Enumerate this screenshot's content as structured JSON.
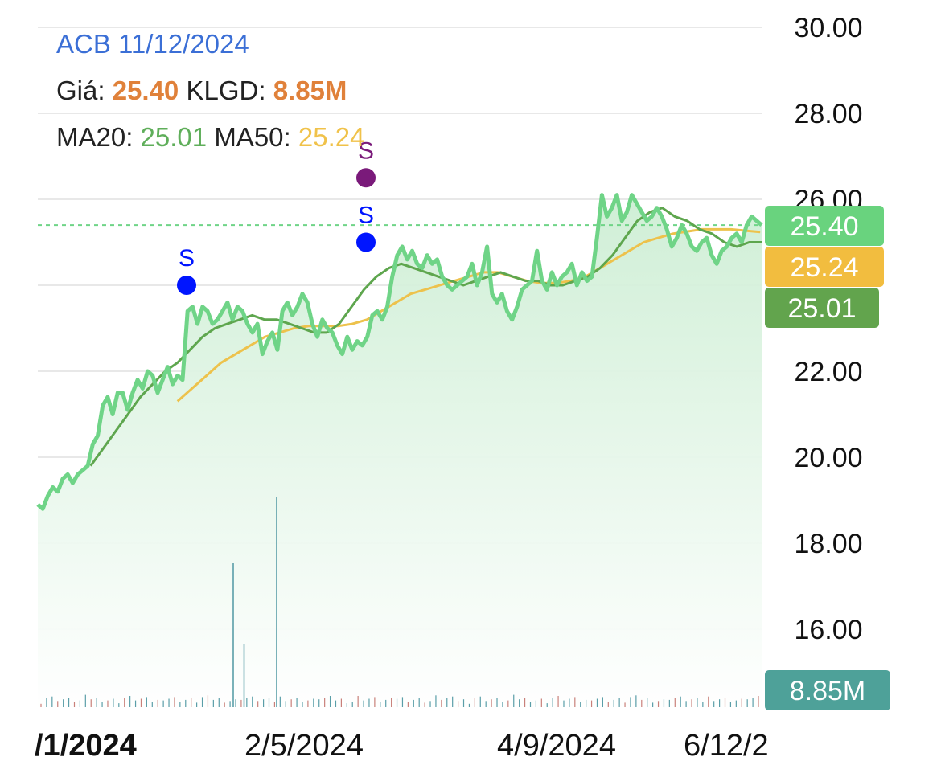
{
  "header": {
    "ticker_date": "ACB 11/12/2024",
    "price_label": "Giá:",
    "price_value": "25.40",
    "volume_label": "KLGD:",
    "volume_value": "8.85M",
    "ma20_label": "MA20:",
    "ma20_value": "25.01",
    "ma50_label": "MA50:",
    "ma50_value": "25.24"
  },
  "badges": {
    "price": "25.40",
    "ma50": "25.24",
    "ma20": "25.01",
    "volume": "8.85M"
  },
  "colors": {
    "price_line": "#6fd487",
    "price_fill_top": "#cdeed4",
    "ma20": "#5ea64e",
    "ma50": "#edc24c",
    "grid": "#e8e8e8",
    "volume_bar": "#5a9ea8",
    "price_badge": "#69d37e",
    "ma50_badge": "#f2bd3f",
    "ma20_badge": "#62a44d",
    "volume_badge": "#4ea199",
    "signal_blue": "#0015ff",
    "signal_purple": "#7a1a7a"
  },
  "chart_data": {
    "type": "line",
    "ylim": [
      14,
      30.6
    ],
    "y_ticks": [
      "30.00",
      "28.00",
      "26.00",
      "22.00",
      "20.00",
      "18.00",
      "16.00"
    ],
    "x_ticks": [
      "/1/2024",
      "2/5/2024",
      "4/9/2024",
      "6/12/2"
    ],
    "current_price": 25.4,
    "series": [
      {
        "name": "Giá",
        "values": [
          18.9,
          18.8,
          19.1,
          19.3,
          19.2,
          19.5,
          19.6,
          19.4,
          19.6,
          19.7,
          19.8,
          20.3,
          20.5,
          21.2,
          21.4,
          21.0,
          21.5,
          21.5,
          21.1,
          21.5,
          21.8,
          21.6,
          22.0,
          21.9,
          21.5,
          21.8,
          22.1,
          21.7,
          21.9,
          21.8,
          23.4,
          23.5,
          23.1,
          23.5,
          23.4,
          23.1,
          23.2,
          23.4,
          23.6,
          23.2,
          23.5,
          23.4,
          23.1,
          22.9,
          23.1,
          22.4,
          22.7,
          22.9,
          22.5,
          23.4,
          23.6,
          23.3,
          23.5,
          23.8,
          23.6,
          23.1,
          22.8,
          23.2,
          23.0,
          22.9,
          22.6,
          22.4,
          22.8,
          22.5,
          22.7,
          22.6,
          22.8,
          23.3,
          23.4,
          23.2,
          23.5,
          24.2,
          24.7,
          24.9,
          24.6,
          24.8,
          24.5,
          24.4,
          24.7,
          24.5,
          24.6,
          24.2,
          24.0,
          23.9,
          24.0,
          24.1,
          24.2,
          24.5,
          24.0,
          24.3,
          24.9,
          23.8,
          23.6,
          23.8,
          23.4,
          23.2,
          23.5,
          23.9,
          24.0,
          24.1,
          24.8,
          24.1,
          23.9,
          24.3,
          24.0,
          24.2,
          24.3,
          24.5,
          24.0,
          24.3,
          24.1,
          24.2,
          25.1,
          26.1,
          25.6,
          25.8,
          26.1,
          25.5,
          25.7,
          26.1,
          25.9,
          25.7,
          25.5,
          25.6,
          25.8,
          25.6,
          25.3,
          24.9,
          25.1,
          25.4,
          25.2,
          24.9,
          24.8,
          25.0,
          25.1,
          24.7,
          24.5,
          24.8,
          24.9,
          25.1,
          25.2,
          25.0,
          25.4,
          25.6,
          25.5,
          25.4
        ],
        "stroke": "#6fd487"
      },
      {
        "name": "MA20",
        "values": [
          19.8,
          20.2,
          20.6,
          21.0,
          21.4,
          21.7,
          22.0,
          22.2,
          22.5,
          22.8,
          23.0,
          23.1,
          23.2,
          23.3,
          23.2,
          23.2,
          23.1,
          23.0,
          22.9,
          22.9,
          23.1,
          23.5,
          23.9,
          24.2,
          24.4,
          24.5,
          24.4,
          24.3,
          24.2,
          24.1,
          24.0,
          24.1,
          24.2,
          24.3,
          24.2,
          24.1,
          24.1,
          24.0,
          24.0,
          24.1,
          24.2,
          24.4,
          24.7,
          25.1,
          25.5,
          25.7,
          25.8,
          25.6,
          25.5,
          25.3,
          25.2,
          25.0,
          24.9,
          25.0,
          25.0
        ],
        "stroke": "#5ea64e"
      },
      {
        "name": "MA50",
        "values": [
          21.3,
          21.6,
          21.9,
          22.2,
          22.4,
          22.6,
          22.8,
          22.9,
          23.0,
          23.05,
          23.05,
          23.05,
          23.1,
          23.2,
          23.4,
          23.6,
          23.8,
          23.9,
          24.0,
          24.1,
          24.2,
          24.3,
          24.3,
          24.2,
          24.1,
          24.05,
          24.05,
          24.1,
          24.2,
          24.4,
          24.6,
          24.8,
          25.0,
          25.1,
          25.2,
          25.25,
          25.3,
          25.3,
          25.3,
          25.27,
          25.24
        ],
        "stroke": "#edc24c"
      }
    ],
    "signals": [
      {
        "label": "S",
        "price": 24.0
      },
      {
        "label": "S",
        "price": 25.0
      },
      {
        "label": "S",
        "price": 26.5
      }
    ],
    "volume": {
      "max_label": "8.85M",
      "spikes": [
        {
          "at": 0.27,
          "value": 6.0
        },
        {
          "at": 0.285,
          "value": 2.6
        },
        {
          "at": 0.33,
          "value": 8.7
        }
      ]
    }
  }
}
